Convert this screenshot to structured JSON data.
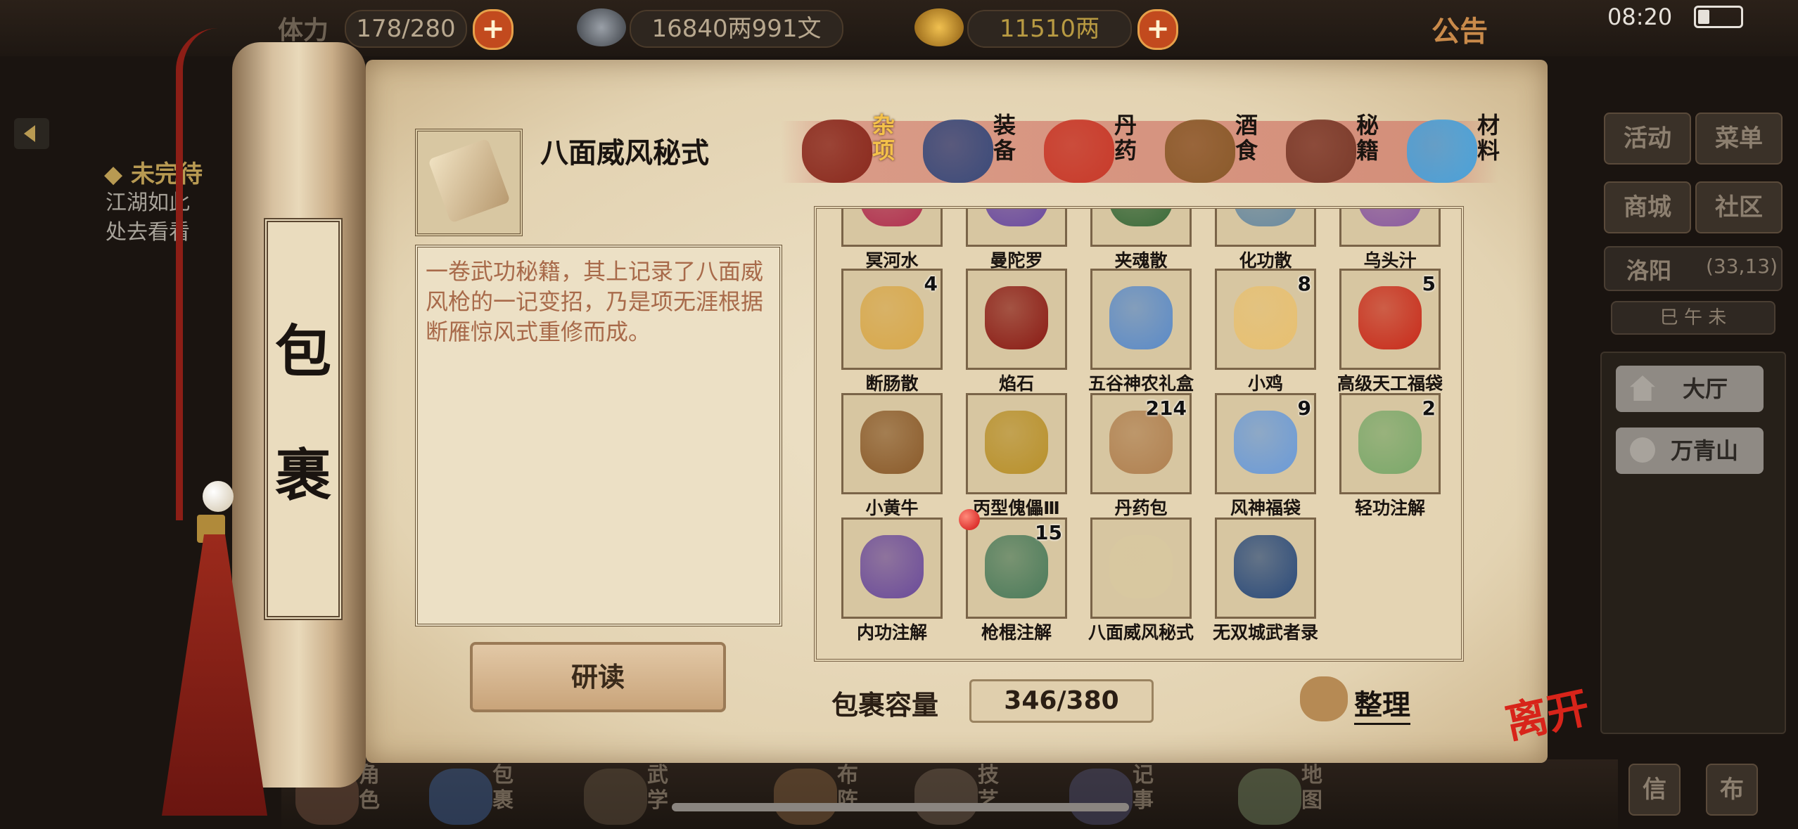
{
  "status_bar": {
    "stamina_label": "体力",
    "stamina_value": "178/280",
    "silver_value": "16840两991文",
    "gold_value": "11510两",
    "notice_label": "公告",
    "clock": "08:20"
  },
  "left_panel": {
    "quest_title": "◆ 未完待",
    "quest_line1": "江湖如此",
    "quest_line2": "处去看看"
  },
  "right_panel": {
    "buttons": [
      "活动",
      "菜单",
      "商城",
      "社区"
    ],
    "location_name": "洛阳",
    "location_coords": "(33,13)",
    "compass": "巳 午 未",
    "rooms": [
      "大厅",
      "万青山"
    ],
    "bottom_buttons": [
      "信",
      "布"
    ]
  },
  "scroll_tag": {
    "char1": "包",
    "char2": "裹"
  },
  "selected_item": {
    "name": "八面威风秘式",
    "description": "一卷武功秘籍，其上记录了八面威风枪的一记变招，乃是项无涯根据断雁惊风式重修而成。",
    "action_label": "研读"
  },
  "categories": [
    {
      "label": "杂项",
      "active": true,
      "icon": "jar-icon",
      "color": "#8a2a1e"
    },
    {
      "label": "装备",
      "active": false,
      "icon": "armor-icon",
      "color": "#3a4a7a"
    },
    {
      "label": "丹药",
      "active": false,
      "icon": "pills-icon",
      "color": "#c83a2a"
    },
    {
      "label": "酒食",
      "active": false,
      "icon": "wine-food-icon",
      "color": "#8a5a2a"
    },
    {
      "label": "秘籍",
      "active": false,
      "icon": "books-icon",
      "color": "#7a3a2a"
    },
    {
      "label": "材料",
      "active": false,
      "icon": "crystal-icon",
      "color": "#4aa0d8"
    }
  ],
  "inventory_rows": [
    [
      {
        "name": "冥河水",
        "count": "",
        "icon": "bottle-icon",
        "color": "#b03050"
      },
      {
        "name": "曼陀罗",
        "count": "",
        "icon": "box-icon",
        "color": "#6a4aa0"
      },
      {
        "name": "夹魂散",
        "count": "",
        "icon": "powder-icon",
        "color": "#3a6a3a"
      },
      {
        "name": "化功散",
        "count": "",
        "icon": "powder-icon",
        "color": "#6a8aa0"
      },
      {
        "name": "乌头汁",
        "count": "",
        "icon": "flask-icon",
        "color": "#8a5aa0"
      }
    ],
    [
      {
        "name": "断肠散",
        "count": "4",
        "icon": "bowl-icon",
        "color": "#d8a84a"
      },
      {
        "name": "焰石",
        "count": "",
        "icon": "red-stone-icon",
        "color": "#8a1a14"
      },
      {
        "name": "五谷神农礼盒",
        "count": "",
        "icon": "gift-box-icon",
        "color": "#5a8ac8"
      },
      {
        "name": "小鸡",
        "count": "8",
        "icon": "chicks-icon",
        "color": "#e8c070"
      },
      {
        "name": "高级天工福袋",
        "count": "5",
        "icon": "lucky-bag-icon",
        "color": "#c82a1a"
      }
    ],
    [
      {
        "name": "小黄牛",
        "count": "",
        "icon": "ox-icon",
        "color": "#8a5a2a"
      },
      {
        "name": "丙型傀儡Ⅲ",
        "count": "",
        "icon": "puppet-icon",
        "color": "#b8902a"
      },
      {
        "name": "丹药包",
        "count": "214",
        "icon": "pouch-icon",
        "color": "#b08050"
      },
      {
        "name": "风神福袋",
        "count": "9",
        "icon": "blue-bag-icon",
        "color": "#6a9ad8"
      },
      {
        "name": "轻功注解",
        "count": "2",
        "icon": "scroll-map-icon",
        "color": "#7aa86a"
      }
    ],
    [
      {
        "name": "内功注解",
        "count": "",
        "icon": "scroll-cauldron-icon",
        "color": "#6a4a9a"
      },
      {
        "name": "枪棍注解",
        "count": "15",
        "icon": "scroll-spear-icon",
        "color": "#4a7a5a",
        "new": true
      },
      {
        "name": "八面威风秘式",
        "count": "",
        "icon": "scroll-check-icon",
        "color": "#d8c8a0"
      },
      {
        "name": "无双城武者录",
        "count": "",
        "icon": "book-icon",
        "color": "#2a4a7a"
      }
    ]
  ],
  "capacity": {
    "label": "包裹容量",
    "value": "346/380"
  },
  "sort_label": "整理",
  "leave_label": "离开",
  "bottom_nav": [
    "角色",
    "包裹",
    "武学",
    "布阵",
    "技艺",
    "记事",
    "地图"
  ]
}
